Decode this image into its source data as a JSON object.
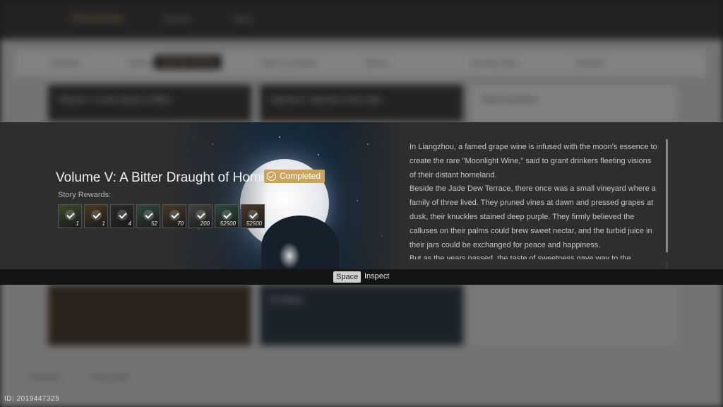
{
  "background": {
    "nav_title": "Chronicles",
    "nav_tabs": [
      "Events",
      "Tales"
    ],
    "filters": [
      "Chapters",
      "Volume",
      "Tales of Jianghu",
      "Rivers",
      "Ancient Tales",
      "Episode"
    ],
    "active_filter": "Selected Stories",
    "cards": [
      "Volume I: In the Quest of Bliss",
      "Volume II: Swords in the Lake",
      "Ode to Autumn",
      "At Home"
    ],
    "bottom_links": [
      "Rewards",
      "Story Menu"
    ]
  },
  "banner": {
    "title": "Volume V: A Bitter Draught of Home",
    "status": "Completed",
    "rewards_label": "Story Rewards:",
    "rewards": [
      {
        "icon": "jade-token-icon",
        "qty": "1",
        "color": "#3a4a2a"
      },
      {
        "icon": "gold-ingot-icon",
        "qty": "1",
        "color": "#4a3a20"
      },
      {
        "icon": "ink-brush-icon",
        "qty": "4",
        "color": "#2a2a2a"
      },
      {
        "icon": "jade-pendant-icon",
        "qty": "52",
        "color": "#2e4a3c"
      },
      {
        "icon": "wooden-box-icon",
        "qty": "70",
        "color": "#4a3a2a"
      },
      {
        "icon": "silver-coin-icon",
        "qty": "200",
        "color": "#444444"
      },
      {
        "icon": "jade-coin-icon",
        "qty": "52500",
        "color": "#2f4a40"
      },
      {
        "icon": "copper-coin-icon",
        "qty": "52500",
        "color": "#4a3a28"
      }
    ],
    "description": [
      "In Liangzhou, a famed grape wine is infused with the moon's essence to create the rare \"Moonlight Wine,\" said to grant drinkers fleeting visions of their distant homeland.",
      "Beside the Jade Dew Terrace, there once was a small vineyard where a family of three lived. They pruned vines at dawn and pressed grapes at dusk, their knuckles stained deep purple. They firmly believed the calluses on their palms could brew sweet nectar, and the turbid juice in their jars could be exchanged for peace and happiness.",
      "But as the years passed, the taste of sweetness gave way to the bitterness of"
    ]
  },
  "hint": {
    "key": "Space",
    "label": "Inspect"
  },
  "uid": "ID: 2019447325"
}
